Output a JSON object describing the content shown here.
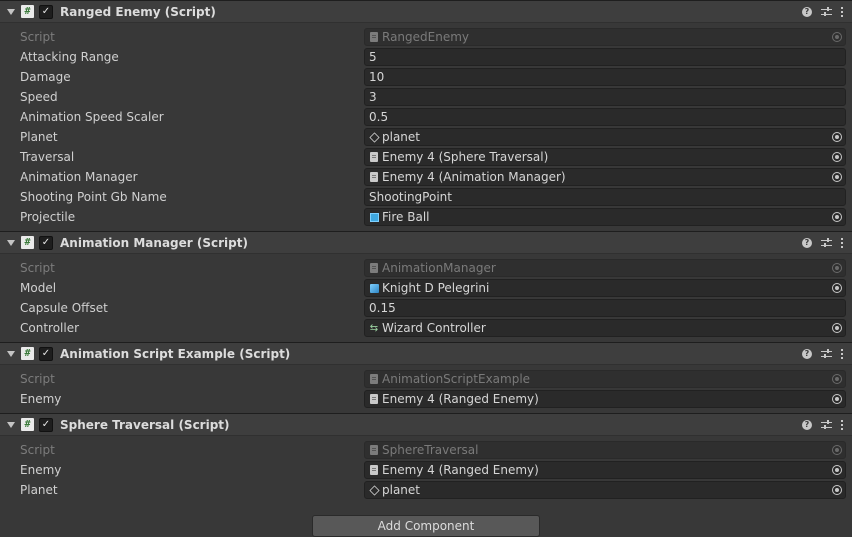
{
  "components": [
    {
      "title": "Ranged Enemy (Script)",
      "enabled": true,
      "properties": [
        {
          "label": "Script",
          "value": "RangedEnemy",
          "disabled": true,
          "icon": "script-doc-icon",
          "picker": true
        },
        {
          "label": "Attacking Range",
          "value": "5"
        },
        {
          "label": "Damage",
          "value": "10"
        },
        {
          "label": "Speed",
          "value": "3"
        },
        {
          "label": "Animation Speed Scaler",
          "value": "0.5"
        },
        {
          "label": "Planet",
          "value": "planet",
          "icon": "gameobject-icon",
          "picker": true
        },
        {
          "label": "Traversal",
          "value": "Enemy 4 (Sphere Traversal)",
          "icon": "script-doc-icon",
          "picker": true
        },
        {
          "label": "Animation Manager",
          "value": "Enemy 4 (Animation Manager)",
          "icon": "script-doc-icon",
          "picker": true
        },
        {
          "label": "Shooting Point Gb Name",
          "value": "ShootingPoint"
        },
        {
          "label": "Projectile",
          "value": "Fire Ball",
          "icon": "prefab-icon",
          "picker": true
        }
      ]
    },
    {
      "title": "Animation Manager (Script)",
      "enabled": true,
      "properties": [
        {
          "label": "Script",
          "value": "AnimationManager",
          "disabled": true,
          "icon": "script-doc-icon",
          "picker": true
        },
        {
          "label": "Model",
          "value": "Knight D Pelegrini",
          "icon": "model-prefab-icon",
          "picker": true
        },
        {
          "label": "Capsule Offset",
          "value": "0.15"
        },
        {
          "label": "Controller",
          "value": "Wizard Controller",
          "icon": "animator-controller-icon",
          "picker": true
        }
      ]
    },
    {
      "title": "Animation Script Example (Script)",
      "enabled": true,
      "properties": [
        {
          "label": "Script",
          "value": "AnimationScriptExample",
          "disabled": true,
          "icon": "script-doc-icon",
          "picker": true
        },
        {
          "label": "Enemy",
          "value": "Enemy 4 (Ranged Enemy)",
          "icon": "script-doc-icon",
          "picker": true
        }
      ]
    },
    {
      "title": "Sphere Traversal (Script)",
      "enabled": true,
      "properties": [
        {
          "label": "Script",
          "value": "SphereTraversal",
          "disabled": true,
          "icon": "script-doc-icon",
          "picker": true
        },
        {
          "label": "Enemy",
          "value": "Enemy 4 (Ranged Enemy)",
          "icon": "script-doc-icon",
          "picker": true
        },
        {
          "label": "Planet",
          "value": "planet",
          "icon": "gameobject-icon",
          "picker": true
        }
      ]
    }
  ],
  "icons": {
    "script": "#",
    "checkmark": "✓",
    "help": "?",
    "animator_controller": "⇆"
  },
  "add_component_label": "Add Component",
  "colors": {
    "background": "#383838",
    "header": "#3e3e3e",
    "field": "#2a2a2a",
    "prefab_blue": "#3fa8e0"
  }
}
